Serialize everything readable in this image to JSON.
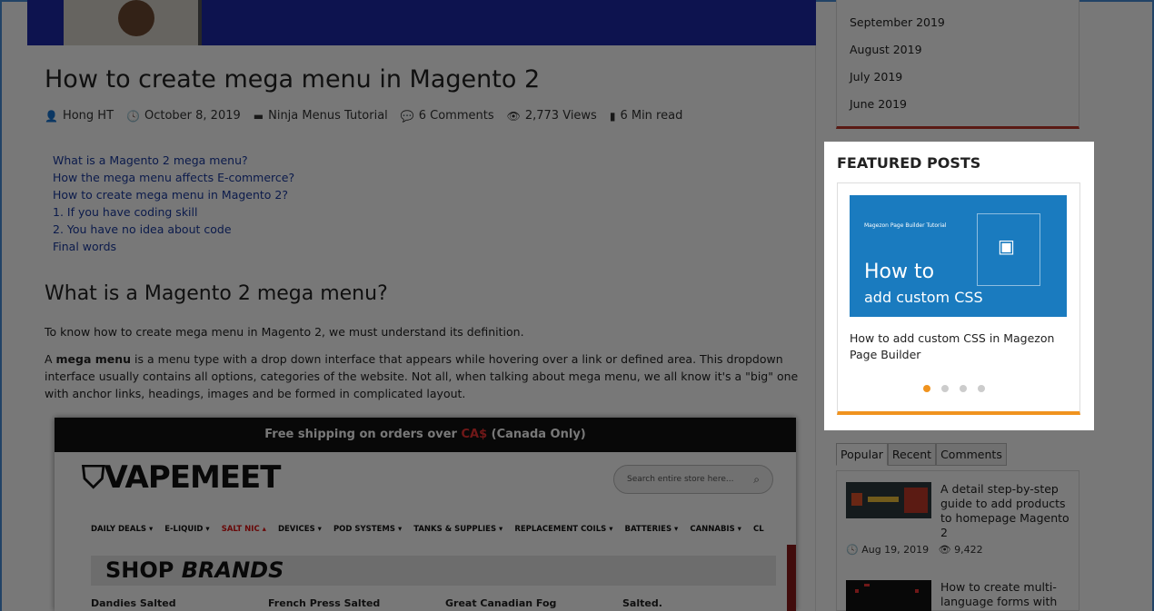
{
  "article": {
    "title": "How to create mega menu in Magento 2",
    "meta": {
      "author": "Hong HT",
      "date": "October 8, 2019",
      "category": "Ninja Menus Tutorial",
      "comments": "6 Comments",
      "views": "2,773 Views",
      "read_time": "6 Min read"
    },
    "toc": [
      "What is a Magento 2 mega menu?",
      "How the mega menu affects E-commerce?",
      "How to create mega menu in Magento 2?",
      "1. If you have coding skill",
      "2. You have no idea about code",
      "Final words"
    ],
    "section_heading": "What is a Magento 2 mega menu?",
    "para1": "To know how to create mega menu in Magento 2, we must understand its definition.",
    "para2_bold": "mega menu",
    "para2_pre": "A ",
    "para2_post": " is a menu type with a drop down interface that appears while hovering over a link or defined area. This dropdown interface usually contains all options, categories of the website. Not all, when talking about mega menu, we all know it's a \"big\" one with anchor links, headings, images and be formed in complicated layout."
  },
  "screenshot": {
    "banner_pre": "Free shipping on orders over ",
    "banner_hidden": "CA$",
    "banner_post": " (Canada Only)",
    "logo": "VAPEMEET",
    "search_placeholder": "Search entire store here...",
    "nav": [
      "DAILY DEALS ▾",
      "E-LIQUID ▾",
      "SALT NIC ▴",
      "DEVICES ▾",
      "POD SYSTEMS ▾",
      "TANKS & SUPPLIES ▾",
      "REPLACEMENT COILS ▾",
      "BATTERIES ▾",
      "CANNABIS ▾",
      "CL"
    ],
    "brands_heading_1": "SHOP ",
    "brands_heading_2": "BRANDS",
    "brands": [
      "Dandies Salted",
      "French Press Salted",
      "Great Canadian Fog",
      "Salted."
    ]
  },
  "sidebar": {
    "archives": [
      "September 2019",
      "August 2019",
      "July 2019",
      "June 2019"
    ],
    "featured": {
      "heading": "FEATURED POSTS",
      "thumb_small": "Magezon Page Builder Tutorial",
      "thumb_big1": "How to",
      "thumb_big2": "add custom CSS",
      "post_title": "How to add custom CSS in Magezon Page Builder",
      "active_slide": 1,
      "slide_count": 4
    },
    "tabs": [
      "Popular",
      "Recent",
      "Comments"
    ],
    "active_tab": "Popular",
    "posts": [
      {
        "title": "A detail step-by-step guide to add products to homepage Magento 2",
        "date": "Aug 19, 2019",
        "views": "9,422"
      },
      {
        "title": "How to create multi-language forms with",
        "date": "",
        "views": ""
      }
    ]
  },
  "colors": {
    "accent_orange": "#f0931f",
    "archive_border_red": "#c0392b",
    "link_blue": "#1a3aa0",
    "hero_blue": "#1d2aa8"
  }
}
